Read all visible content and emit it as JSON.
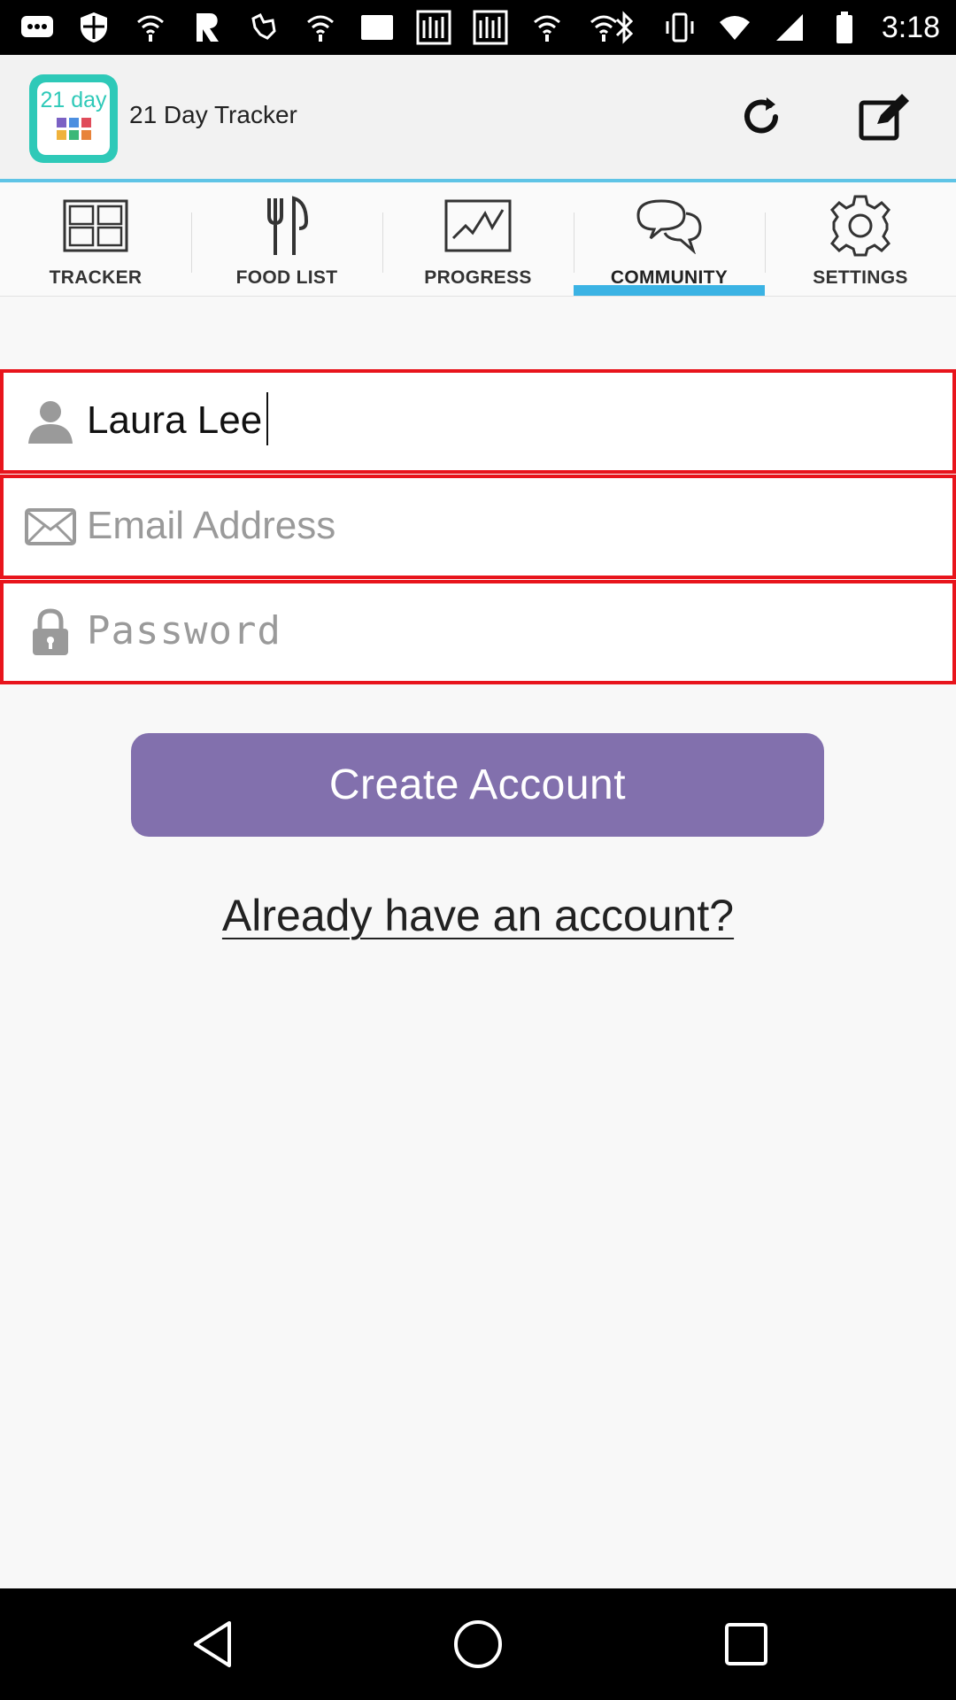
{
  "status_bar": {
    "time": "3:18",
    "notification_icons": [
      "message-icon",
      "shield-icon",
      "wifi-icon",
      "app-r-icon",
      "animal-icon",
      "wifi-icon",
      "notification-icon",
      "rfi-icon",
      "rfi-icon",
      "wifi-icon",
      "wifi-icon"
    ],
    "system_icons": [
      "bluetooth-icon",
      "vibrate-icon",
      "wifi-icon",
      "signal-icon",
      "battery-icon"
    ]
  },
  "app_bar": {
    "logo_text": "21 day",
    "title": "21 Day Tracker",
    "logo_colors": [
      "#7b61c4",
      "#4c8fe0",
      "#e04c5b",
      "#f0b23c",
      "#3cb878",
      "#e8833a"
    ],
    "accent": "#5fc4e6"
  },
  "tabs": [
    {
      "label": "TRACKER",
      "icon": "grid-icon",
      "active": false
    },
    {
      "label": "FOOD LIST",
      "icon": "utensils-icon",
      "active": false
    },
    {
      "label": "PROGRESS",
      "icon": "chart-icon",
      "active": false
    },
    {
      "label": "COMMUNITY",
      "icon": "chat-bubbles-icon",
      "active": true
    },
    {
      "label": "SETTINGS",
      "icon": "gear-icon",
      "active": false
    }
  ],
  "form": {
    "name_value": "Laura Lee",
    "email_placeholder": "Email Address",
    "password_placeholder": "Password",
    "field_border_color": "#e8141c"
  },
  "actions": {
    "create_account": "Create Account",
    "already_have_account": "Already have an account?",
    "button_color": "#8270ad"
  }
}
